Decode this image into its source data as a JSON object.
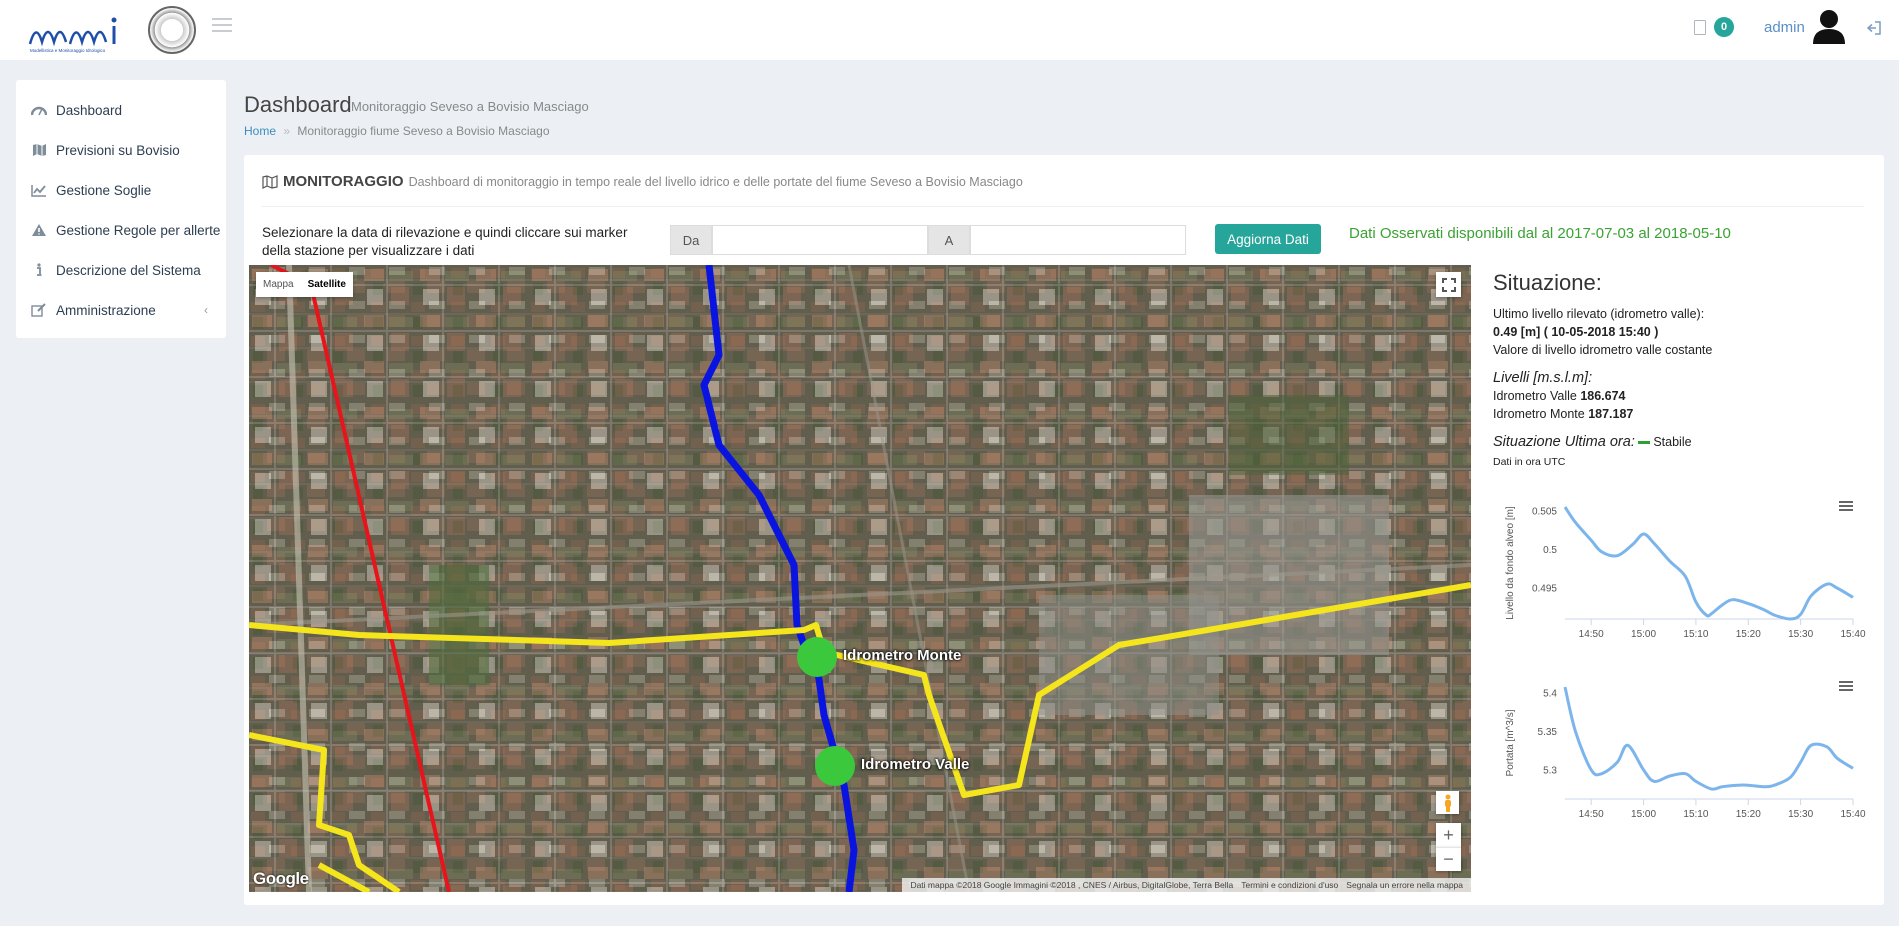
{
  "header": {
    "logo_text": "mmi",
    "logo_caption": "Modellistica e Monitoraggio Idrologico",
    "notification_count": "0",
    "user": "admin"
  },
  "sidebar": {
    "items": [
      {
        "label": "Dashboard",
        "icon": "dashboard-icon"
      },
      {
        "label": "Previsioni su Bovisio",
        "icon": "map-icon"
      },
      {
        "label": "Gestione Soglie",
        "icon": "line-chart-icon"
      },
      {
        "label": "Gestione Regole per allerte",
        "icon": "warning-icon"
      },
      {
        "label": "Descrizione del Sistema",
        "icon": "info-icon"
      },
      {
        "label": "Amministrazione",
        "icon": "edit-icon",
        "chevron": "‹"
      }
    ]
  },
  "page": {
    "title": "Dashboard",
    "subtitle": "Monitoraggio Seveso a Bovisio Masciago",
    "breadcrumb_home": "Home",
    "breadcrumb_sep": "»",
    "breadcrumb_current": "Monitoraggio fiume Seveso a Bovisio Masciago"
  },
  "box": {
    "title": "MONITORAGGIO",
    "description": "Dashboard di monitoraggio in tempo reale del livello idrico e delle portate del fiume Seveso a Bovisio Masciago",
    "instructions": "Selezionare la data di rilevazione e quindi cliccare sui marker della stazione per visualizzare i dati",
    "from_label": "Da",
    "to_label": "A",
    "from_value": "",
    "to_value": "",
    "update_button": "Aggiorna Dati",
    "availability": "Dati Osservati disponibili dal al 2017-07-03 al 2018-05-10"
  },
  "map": {
    "type_map": "Mappa",
    "type_satellite": "Satellite",
    "active_type": "Satellite",
    "marker_monte": "Idrometro Monte",
    "marker_valle": "Idrometro Valle",
    "google": "Google",
    "attribution": "Dati mappa ©2018 Google Immagini ©2018 , CNES / Airbus, DigitalGlobe, Terra Bella",
    "terms": "Termini e condizioni d'uso",
    "report": "Segnala un errore nella mappa",
    "zoom_in": "+",
    "zoom_out": "−",
    "colors": {
      "river": "#0a14e0",
      "yellow_line": "#f5e51c",
      "red_line": "#e8141c",
      "marker": "#3cc83c"
    }
  },
  "situation": {
    "title": "Situazione:",
    "last_level_label": "Ultimo livello rilevato (idrometro valle):",
    "last_level_value": "0.49 [m] ( 10-05-2018 15:40 )",
    "level_note": "Valore di livello idrometro valle costante",
    "levels_title": "Livelli [m.s.l.m]:",
    "valle_label": "Idrometro Valle ",
    "valle_value": "186.674",
    "monte_label": "Idrometro Monte ",
    "monte_value": "187.187",
    "last_hour_title": "Situazione Ultima ora:",
    "last_hour_status": "Stabile",
    "utc_note": "Dati in ora UTC"
  },
  "chart_data": [
    {
      "type": "line",
      "ylabel": "Livello da fondo alveo [m]",
      "x_ticks": [
        "14:50",
        "15:00",
        "15:10",
        "15:20",
        "15:30",
        "15:40"
      ],
      "y_ticks": [
        "0.505",
        "0.5",
        "0.495"
      ],
      "ylim": [
        0.491,
        0.5055
      ],
      "x": [
        "14:45",
        "14:47",
        "14:50",
        "14:52",
        "14:55",
        "14:58",
        "15:00",
        "15:02",
        "15:05",
        "15:08",
        "15:10",
        "15:12",
        "15:13",
        "15:15",
        "15:17",
        "15:20",
        "15:23",
        "15:25",
        "15:28",
        "15:30",
        "15:32",
        "15:35",
        "15:37",
        "15:40"
      ],
      "values": [
        0.5055,
        0.5035,
        0.5012,
        0.4997,
        0.4992,
        0.5007,
        0.502,
        0.5008,
        0.4985,
        0.4965,
        0.4932,
        0.4915,
        0.4917,
        0.4928,
        0.4935,
        0.493,
        0.4922,
        0.4915,
        0.491,
        0.4916,
        0.494,
        0.4955,
        0.495,
        0.4938
      ],
      "color": "#7cb5ec"
    },
    {
      "type": "line",
      "ylabel": "Portata [m^3/s]",
      "x_ticks": [
        "14:50",
        "15:00",
        "15:10",
        "15:20",
        "15:30",
        "15:40"
      ],
      "y_ticks": [
        "5.4",
        "5.35",
        "5.3"
      ],
      "ylim": [
        5.262,
        5.408
      ],
      "x": [
        "14:45",
        "14:47",
        "14:50",
        "14:52",
        "14:55",
        "14:57",
        "15:00",
        "15:02",
        "15:05",
        "15:08",
        "15:10",
        "15:13",
        "15:15",
        "15:18",
        "15:20",
        "15:23",
        "15:25",
        "15:28",
        "15:30",
        "15:32",
        "15:35",
        "15:37",
        "15:40"
      ],
      "values": [
        5.408,
        5.35,
        5.3,
        5.295,
        5.31,
        5.332,
        5.3,
        5.285,
        5.292,
        5.295,
        5.285,
        5.275,
        5.278,
        5.28,
        5.28,
        5.278,
        5.28,
        5.29,
        5.31,
        5.332,
        5.33,
        5.315,
        5.302
      ],
      "color": "#7cb5ec"
    }
  ]
}
